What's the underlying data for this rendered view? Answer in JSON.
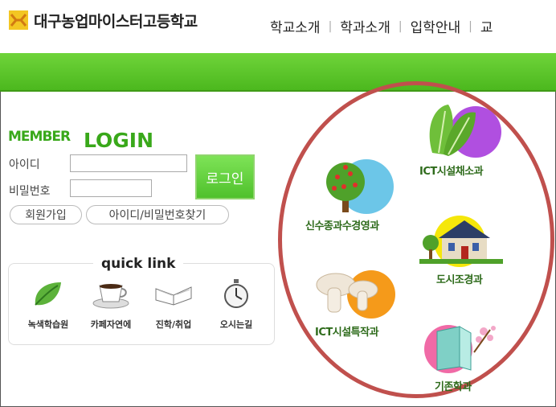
{
  "header": {
    "school_name": "대구농업마이스터고등학교",
    "nav": [
      "학교소개",
      "학과소개",
      "입학안내",
      "교"
    ],
    "separator": "|"
  },
  "login": {
    "member_label": "MEMBER",
    "login_label": "LOGIN",
    "id_label": "아이디",
    "id_value": "",
    "pw_label": "비밀번호",
    "pw_value": "",
    "login_button": "로그인",
    "signup_button": "회원가입",
    "find_button": "아이디/비밀번호찾기"
  },
  "quick_link": {
    "title": "quick link",
    "items": [
      {
        "label": "녹색학습원",
        "icon": "leaf-icon"
      },
      {
        "label": "카페자연에",
        "icon": "coffee-cup-icon"
      },
      {
        "label": "진학/취업",
        "icon": "book-icon"
      },
      {
        "label": "오시는길",
        "icon": "stopwatch-icon"
      }
    ]
  },
  "departments": [
    {
      "label": "ICT시설채소과",
      "icon": "lettuce-icon",
      "accent": "#b04fe0"
    },
    {
      "label": "신수종과수경영과",
      "icon": "fruit-tree-icon",
      "accent": "#6cc6e8"
    },
    {
      "label": "도시조경과",
      "icon": "house-icon",
      "accent": "#f5e70a"
    },
    {
      "label": "ICT시설특작과",
      "icon": "mushroom-icon",
      "accent": "#f59a1a"
    },
    {
      "label": "기존학과",
      "icon": "book-flower-icon",
      "accent": "#f06aa6"
    }
  ],
  "colors": {
    "brand_green": "#39a81a",
    "circle": "#c0504d"
  }
}
